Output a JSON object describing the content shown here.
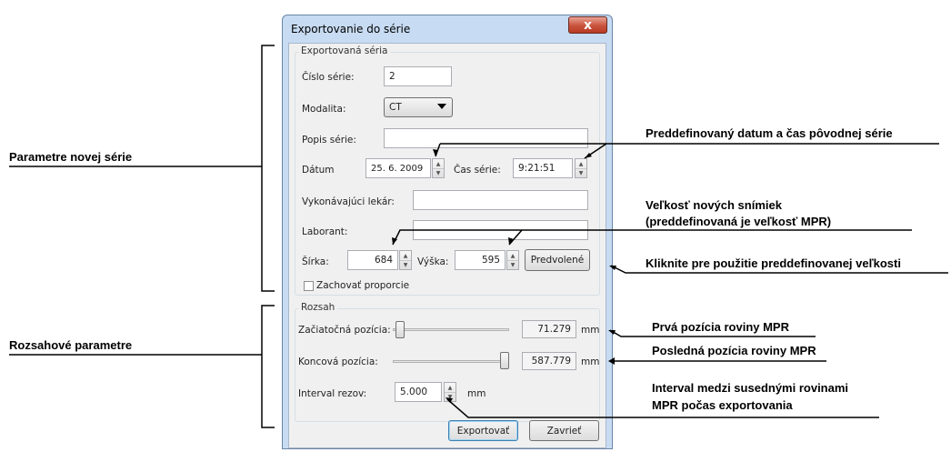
{
  "dialog": {
    "title": "Exportovanie do série",
    "close_glyph": "x",
    "series": {
      "legend": "Exportovaná séria",
      "number_label": "Číslo série:",
      "number_value": "2",
      "modality_label": "Modalita:",
      "modality_value": "CT",
      "description_label": "Popis série:",
      "description_value": "",
      "date_label": "Dátum",
      "date_value": "25.  6. 2009",
      "time_label": "Čas série:",
      "time_value": "9:21:51",
      "physician_label": "Vykonávajúci lekár:",
      "physician_value": "",
      "technician_label": "Laborant:",
      "technician_value": "",
      "width_label": "Šírka:",
      "width_value": "684",
      "height_label": "Výška:",
      "height_value": "595",
      "default_button": "Predvolené",
      "keep_ratio_label": "Zachovať proporcie",
      "keep_ratio_checked": false
    },
    "range": {
      "legend": "Rozsah",
      "start_label": "Začiatočná pozícia:",
      "start_value": "71.279",
      "end_label": "Koncová pozícia:",
      "end_value": "587.779",
      "unit": "mm",
      "interval_label": "Interval rezov:",
      "interval_value": "5.000",
      "interval_unit": "mm"
    },
    "export_button": "Exportovať",
    "close_button": "Zavrieť"
  },
  "annotations": {
    "new_series_params": "Parametre novej série",
    "range_params": "Rozsahové parametre",
    "predefined_datetime": "Preddefinovaný datum a čas pôvodnej série",
    "image_size_line1": "Veľkosť nových snímiek",
    "image_size_line2": "(preddefinovaná je veľkosť MPR)",
    "click_default_size": "Kliknite pre použitie preddefinovanej veľkosti",
    "first_position": "Prvá pozícia roviny MPR",
    "last_position": "Posledná pozícia roviny MPR",
    "interval_line1": "Interval medzi susednými rovinami",
    "interval_line2": "MPR počas exportovania"
  }
}
